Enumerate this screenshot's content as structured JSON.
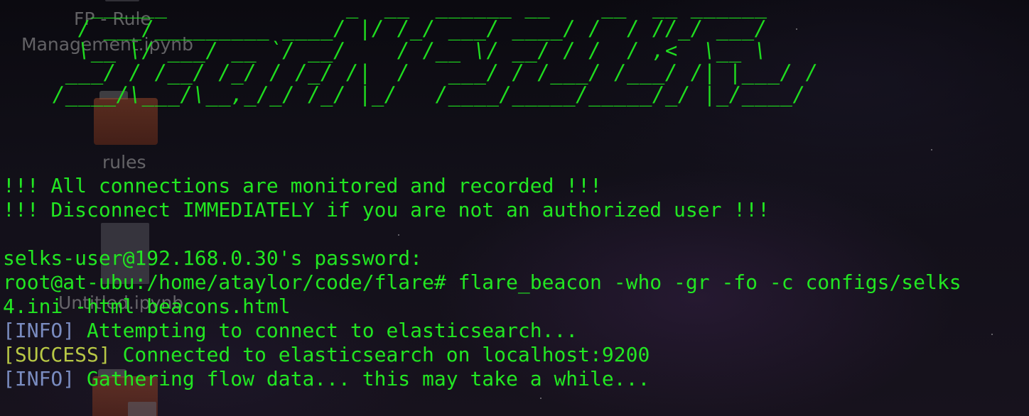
{
  "desktop": {
    "icons": [
      {
        "label": "FP - Rule\nManagement.ipynb",
        "line1": "FP - Rule",
        "line2": "Management.ipynb",
        "type": "notebook-icon"
      },
      {
        "label": "rules",
        "type": "folder-icon"
      },
      {
        "label": "Untitled.ipynb",
        "type": "document-icon"
      },
      {
        "label": "",
        "type": "folder-icon"
      }
    ]
  },
  "terminal": {
    "banner_lines": [
      "       ______              _  __  ______ __    __  __ ______",
      "      / ___/_________ ____/ |/ /_/ ___/ ____/ /  / //_/ ___/",
      "      \\__ \\/ ___/ __ `/ __/    / /__ \\/ __/ / /  / ,<  \\__ \\ ",
      "     ___/ / /__/ /_/ / /_/ /|  /   ___/ / /___/ /___/ /| |___/ / ",
      "    /____/\\___/\\__,_/_/ /_/ |_/   /____/_____/_____/_/ |_/____/  "
    ],
    "warning_1": "!!! All connections are monitored and recorded !!!",
    "warning_2": "!!! Disconnect IMMEDIATELY if you are not an authorized user !!!",
    "password_prompt": "selks-user@192.168.0.30's password:",
    "command_line_1": "root@at-ubu:/home/ataylor/code/flare# flare_beacon -who -gr -fo -c configs/selks",
    "command_line_2": "4.ini -html beacons.html",
    "log": [
      {
        "tag": "[INFO]",
        "message": " Attempting to connect to elasticsearch..."
      },
      {
        "tag": "[SUCCESS]",
        "message": " Connected to elasticsearch on localhost:9200"
      },
      {
        "tag": "[INFO]",
        "message": " Gathering flow data... this may take a while..."
      }
    ]
  },
  "colors": {
    "terminal_green": "#22e622",
    "info_tag": "#7a8cc0",
    "success_tag": "#b8c845",
    "background": "#0b0a10"
  }
}
